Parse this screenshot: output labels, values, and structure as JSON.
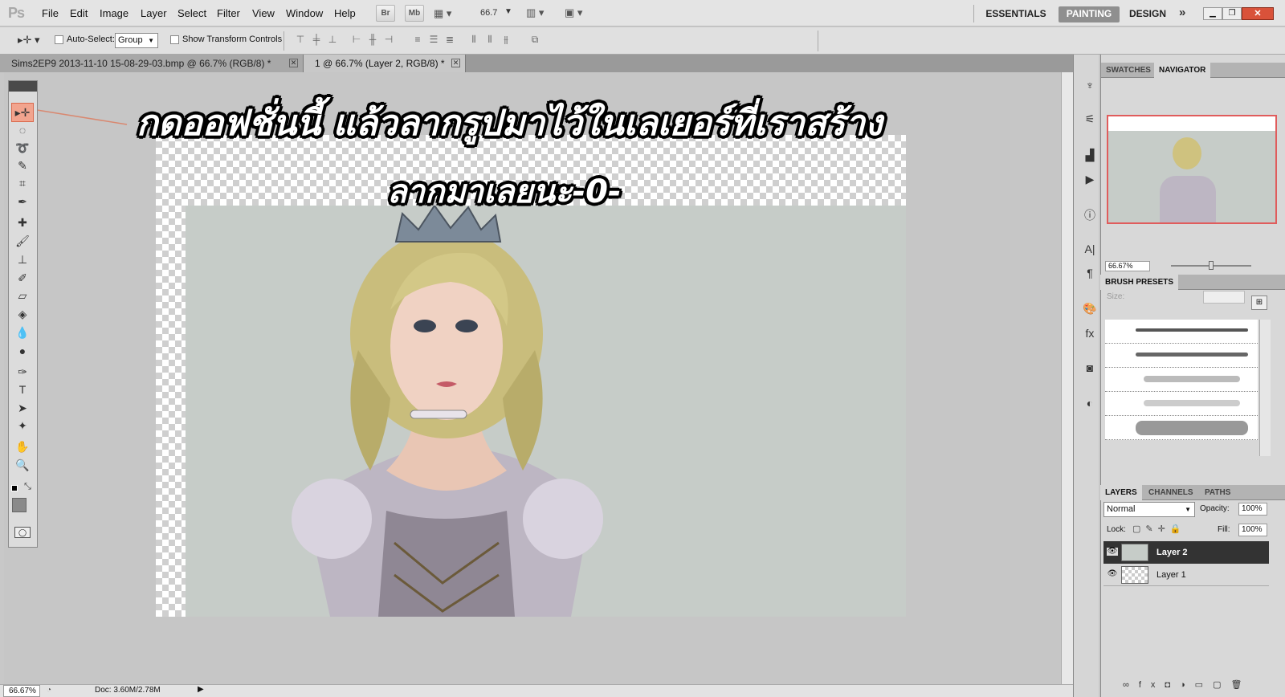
{
  "app": {
    "logo": "Ps"
  },
  "menu": [
    "File",
    "Edit",
    "Image",
    "Layer",
    "Select",
    "Filter",
    "View",
    "Window",
    "Help"
  ],
  "appbar": {
    "bridge": "Br",
    "minibridge": "Mb",
    "zoom": "66.7"
  },
  "workspaces": [
    "ESSENTIALS",
    "PAINTING",
    "DESIGN"
  ],
  "workspace_active": "PAINTING",
  "options": {
    "auto_select_label": "Auto-Select:",
    "auto_select_value": "Group",
    "transform_label": "Show Transform Controls"
  },
  "tabs": [
    {
      "label": "Sims2EP9 2013-11-10 15-08-29-03.bmp @ 66.7% (RGB/8) *"
    },
    {
      "label": "1 @ 66.7% (Layer 2, RGB/8) *"
    }
  ],
  "canvas": {
    "caption_line1": "กดออฟชั่นนี้ แล้วลากรูปมาไว้ในเลเยอร์ที่เราสร้าง",
    "caption_line2": "ลากมาเลยนะ-0-"
  },
  "status": {
    "zoom": "66.67%",
    "doc": "Doc: 3.60M/2.78M"
  },
  "panels": {
    "top_tabs": [
      "SWATCHES",
      "NAVIGATOR"
    ],
    "navigator_zoom": "66.67%",
    "brush_tab": "BRUSH PRESETS",
    "brush_size_label": "Size:",
    "layer_tabs": [
      "LAYERS",
      "CHANNELS",
      "PATHS"
    ],
    "blend_mode": "Normal",
    "opacity_label": "Opacity:",
    "opacity": "100%",
    "lock_label": "Lock:",
    "fill_label": "Fill:",
    "fill": "100%",
    "layers": [
      {
        "name": "Layer 2",
        "selected": true
      },
      {
        "name": "Layer 1",
        "selected": false
      }
    ]
  },
  "colors": {
    "selected_layer": "#333333",
    "highlight": "#e05c5c",
    "menubar": "#e4e4e4"
  }
}
